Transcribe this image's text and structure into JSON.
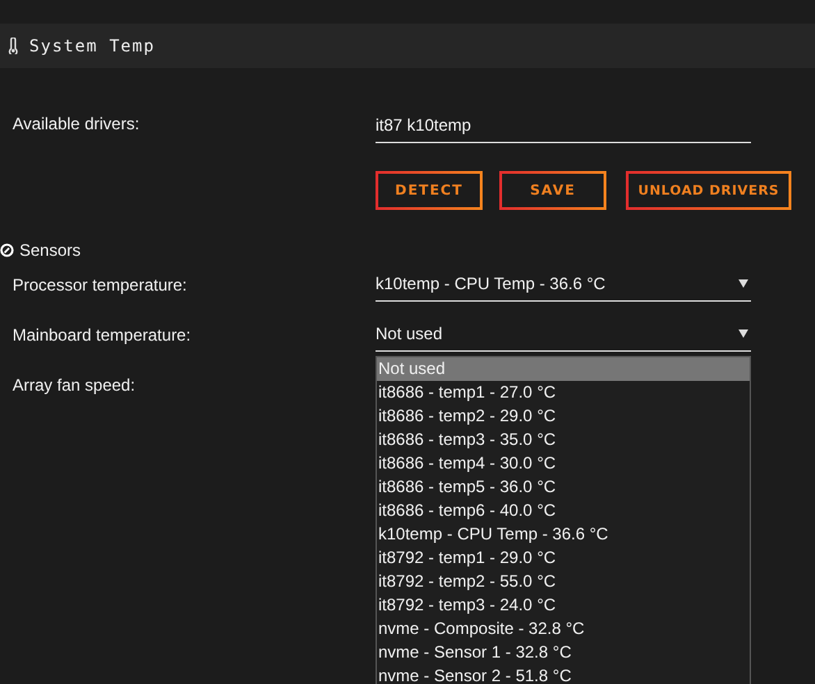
{
  "header": {
    "title": "System Temp"
  },
  "drivers": {
    "label": "Available drivers:",
    "value": "it87 k10temp"
  },
  "buttons": [
    "DETECT",
    "SAVE",
    "UNLOAD DRIVERS"
  ],
  "sensors": {
    "title": "Sensors",
    "rows": [
      {
        "label": "Processor temperature:",
        "value": "k10temp - CPU Temp - 36.6 °C"
      },
      {
        "label": "Mainboard temperature:",
        "value": "Not used",
        "options": [
          {
            "label": "Not used",
            "selected": true
          },
          {
            "label": "it8686 - temp1 - 27.0 °C",
            "selected": false
          },
          {
            "label": "it8686 - temp2 - 29.0 °C",
            "selected": false
          },
          {
            "label": "it8686 - temp3 - 35.0 °C",
            "selected": false
          },
          {
            "label": "it8686 - temp4 - 30.0 °C",
            "selected": false
          },
          {
            "label": "it8686 - temp5 - 36.0 °C",
            "selected": false
          },
          {
            "label": "it8686 - temp6 - 40.0 °C",
            "selected": false
          },
          {
            "label": "k10temp - CPU Temp - 36.6 °C",
            "selected": false
          },
          {
            "label": "it8792 - temp1 - 29.0 °C",
            "selected": false
          },
          {
            "label": "it8792 - temp2 - 55.0 °C",
            "selected": false
          },
          {
            "label": "it8792 - temp3 - 24.0 °C",
            "selected": false
          },
          {
            "label": "nvme - Composite - 32.8 °C",
            "selected": false
          },
          {
            "label": "nvme - Sensor 1 - 32.8 °C",
            "selected": false
          },
          {
            "label": "nvme - Sensor 2 - 51.8 °C",
            "selected": false
          }
        ]
      },
      {
        "label": "Array fan speed:"
      }
    ]
  }
}
